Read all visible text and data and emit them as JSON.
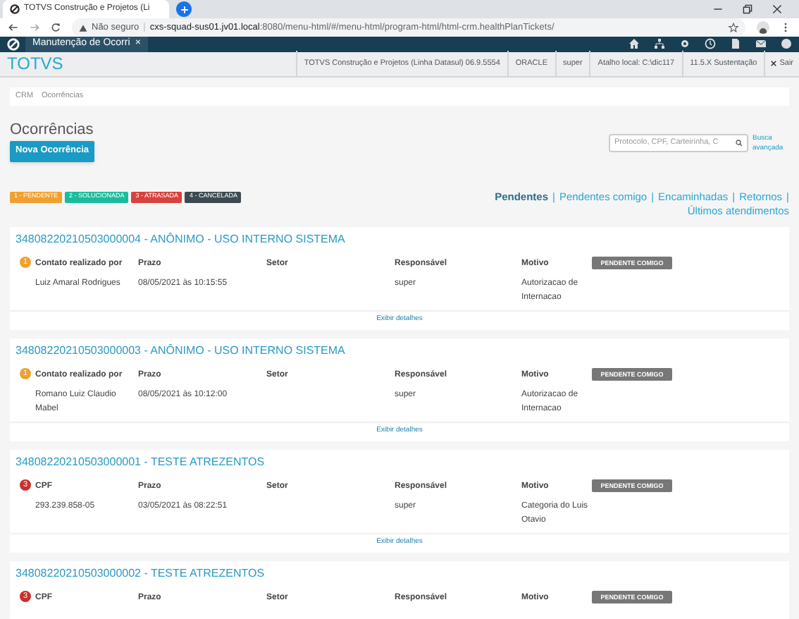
{
  "browser": {
    "tab_title": "TOTVS Construção e Projetos (Li",
    "security": "Não seguro",
    "separator": "|",
    "url_host": "cxs-squad-sus01.jv01.local",
    "url_rest": ":8080/menu-html/#/menu-html/program-html/html-crm.healthPlanTickets/"
  },
  "app_tab": {
    "label": "Manutenção de Ocorri",
    "close": "×"
  },
  "info_bar": {
    "logo": "TOTVS",
    "items": [
      "TOTVS Construção e Projetos (Linha Datasul) 06.9.5554",
      "ORACLE",
      "super",
      "Atalho local: C:\\dic117",
      "11.5.X Sustentação"
    ],
    "logout": "Sair"
  },
  "breadcrumb": [
    "CRM",
    "Ocorrências"
  ],
  "page_title": "Ocorrências",
  "new_button": "Nova Ocorrência",
  "search": {
    "placeholder": "Protocolo, CPF, Carteirinha, C",
    "advanced": "Busca avançada"
  },
  "legend": [
    {
      "label": "1 - PENDENTE",
      "color": "#f0a030"
    },
    {
      "label": "2 - SOLUCIONADA",
      "color": "#1abc9c"
    },
    {
      "label": "3 - ATRASADA",
      "color": "#d9413d"
    },
    {
      "label": "4 - CANCELADA",
      "color": "#3d4a50"
    }
  ],
  "filters": {
    "separator": "|",
    "items": [
      {
        "label": "Pendentes",
        "selected": true
      },
      {
        "label": "Pendentes comigo",
        "selected": false
      },
      {
        "label": "Encaminhadas",
        "selected": false
      },
      {
        "label": "Retornos",
        "selected": false
      },
      {
        "label": "Últimos atendimentos",
        "selected": false
      }
    ]
  },
  "tickets": [
    {
      "title": "34808220210503000004 - ANÔNIMO - USO INTERNO SISTEMA",
      "status": "1",
      "color": "#f0a030",
      "fields": [
        {
          "label": "Contato realizado por",
          "value": "Luiz Amaral Rodrigues"
        },
        {
          "label": "Prazo",
          "value": "08/05/2021 às 10:15:55"
        },
        {
          "label": "Setor"
        },
        {
          "label": "Responsável",
          "value": "super"
        },
        {
          "label": "Motivo",
          "value": "Autorizacao de Internacao"
        }
      ],
      "action": "PENDENTE COMIGO",
      "details": "Exibir detalhes"
    },
    {
      "title": "34808220210503000003 - ANÔNIMO - USO INTERNO SISTEMA",
      "status": "1",
      "color": "#f0a030",
      "fields": [
        {
          "label": "Contato realizado por",
          "value": "Romano Luiz Claudio Mabel"
        },
        {
          "label": "Prazo",
          "value": "08/05/2021 às 10:12:00"
        },
        {
          "label": "Setor"
        },
        {
          "label": "Responsável",
          "value": "super"
        },
        {
          "label": "Motivo",
          "value": "Autorizacao de Internacao"
        }
      ],
      "action": "PENDENTE COMIGO",
      "details": "Exibir detalhes"
    },
    {
      "title": "34808220210503000001 - TESTE ATREZENTOS",
      "status": "3",
      "color": "#c9302c",
      "fields": [
        {
          "label": "CPF",
          "value": "293.239.858-05"
        },
        {
          "label": "Prazo",
          "value": "03/05/2021 às 08:22:51"
        },
        {
          "label": "Setor"
        },
        {
          "label": "Responsável",
          "value": "super"
        },
        {
          "label": "Motivo",
          "value": "Categoria do Luis Otavio"
        }
      ],
      "action": "PENDENTE COMIGO",
      "details": "Exibir detalhes"
    },
    {
      "title": "34808220210503000002 - TESTE ATREZENTOS",
      "status": "3",
      "color": "#c9302c",
      "fields": [
        {
          "label": "CPF"
        },
        {
          "label": "Prazo"
        },
        {
          "label": "Setor"
        },
        {
          "label": "Responsável"
        },
        {
          "label": "Motivo"
        }
      ],
      "action": "PENDENTE COMIGO"
    }
  ]
}
